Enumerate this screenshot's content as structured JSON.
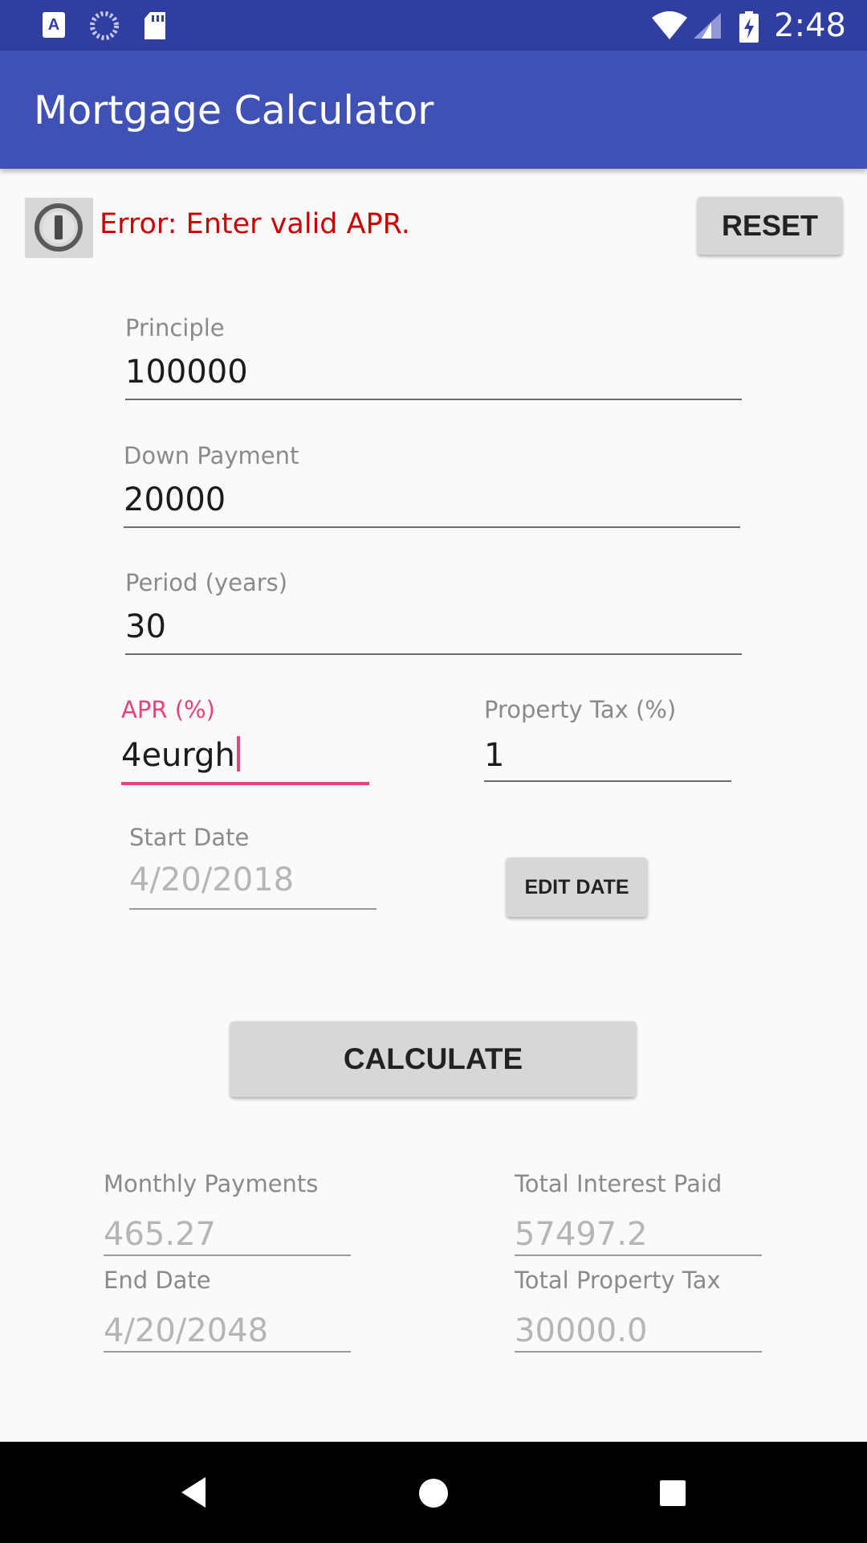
{
  "status_bar": {
    "time": "2:48",
    "icons": [
      "keyboard-a-icon",
      "sync-circle-icon",
      "sd-card-icon",
      "wifi-icon",
      "signal-icon",
      "battery-charging-icon"
    ]
  },
  "app_bar": {
    "title": "Mortgage Calculator"
  },
  "message": {
    "error_text": "Error: Enter valid APR.",
    "error_color": "#cc0000",
    "info_icon": "info-icon"
  },
  "buttons": {
    "reset": "RESET",
    "edit_date": "EDIT DATE",
    "calculate": "CALCULATE"
  },
  "fields": {
    "principle": {
      "label": "Principle",
      "value": "100000"
    },
    "down_payment": {
      "label": "Down Payment",
      "value": "20000"
    },
    "period": {
      "label": "Period (years)",
      "value": "30"
    },
    "apr": {
      "label": "APR (%)",
      "value": "4eurgh",
      "focused": true,
      "accent_color": "#ec407a"
    },
    "property_tax": {
      "label": "Property Tax (%)",
      "value": "1"
    },
    "start_date": {
      "label": "Start Date",
      "value": "4/20/2018",
      "enabled": false
    }
  },
  "results": {
    "monthly_payments": {
      "label": "Monthly Payments",
      "value": "465.27"
    },
    "total_interest_paid": {
      "label": "Total Interest Paid",
      "value": "57497.2"
    },
    "end_date": {
      "label": "End Date",
      "value": "4/20/2048"
    },
    "total_property_tax": {
      "label": "Total Property Tax",
      "value": "30000.0"
    }
  },
  "colors": {
    "status_bar": "#303f9f",
    "app_bar": "#3f51b5",
    "button": "#d6d7d7"
  },
  "nav_bar": {
    "icons": [
      "back-icon",
      "home-icon",
      "recents-icon"
    ]
  }
}
